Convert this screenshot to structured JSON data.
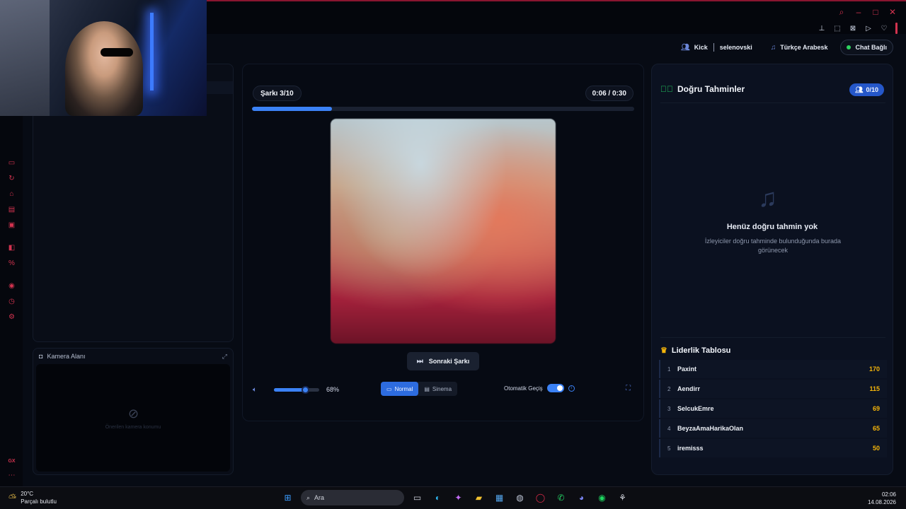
{
  "header": {
    "platform": "Kick",
    "channel": "selenovski",
    "category": "Türkçe Arabesk",
    "chat_status": "Chat Bağlı"
  },
  "camera": {
    "label": "Kamera Alanı",
    "placeholder": "Önerilen kamera konumu"
  },
  "player": {
    "song_counter": "Şarkı 3/10",
    "time": "0:06 / 0:30",
    "progress": 0.21,
    "next_label": "Sonraki Şarkı",
    "volume_value": 68,
    "volume_label": "68%",
    "modes": [
      "Normal",
      "Sinema"
    ],
    "active_mode": "Normal",
    "autoplay_label": "Otomatik Geçiş",
    "autoplay_on": true
  },
  "guesses": {
    "title": "Doğru Tahminler",
    "count": "0/10",
    "empty_title": "Henüz doğru tahmin yok",
    "empty_desc": "İzleyiciler doğru tahminde bulunduğunda burada görünecek"
  },
  "leaderboard": {
    "title": "Liderlik Tablosu",
    "rows": [
      {
        "rank": "1",
        "name": "Paxint",
        "score": "170"
      },
      {
        "rank": "2",
        "name": "Aendirr",
        "score": "115"
      },
      {
        "rank": "3",
        "name": "SelcukEmre",
        "score": "69"
      },
      {
        "rank": "4",
        "name": "BeyzaAmaHarikaOlan",
        "score": "65"
      },
      {
        "rank": "5",
        "name": "iremisss",
        "score": "50"
      }
    ]
  },
  "rail_footer": "GX",
  "taskbar": {
    "weather_temp": "20°C",
    "weather_desc": "Parçalı bulutlu",
    "search_label": "Ara",
    "time": "02:06",
    "date": "14.08.2026"
  },
  "colors": {
    "accent": "#3b82f6",
    "brand_red": "#d2334f",
    "success": "#22c55e",
    "gold": "#f5b50a"
  }
}
